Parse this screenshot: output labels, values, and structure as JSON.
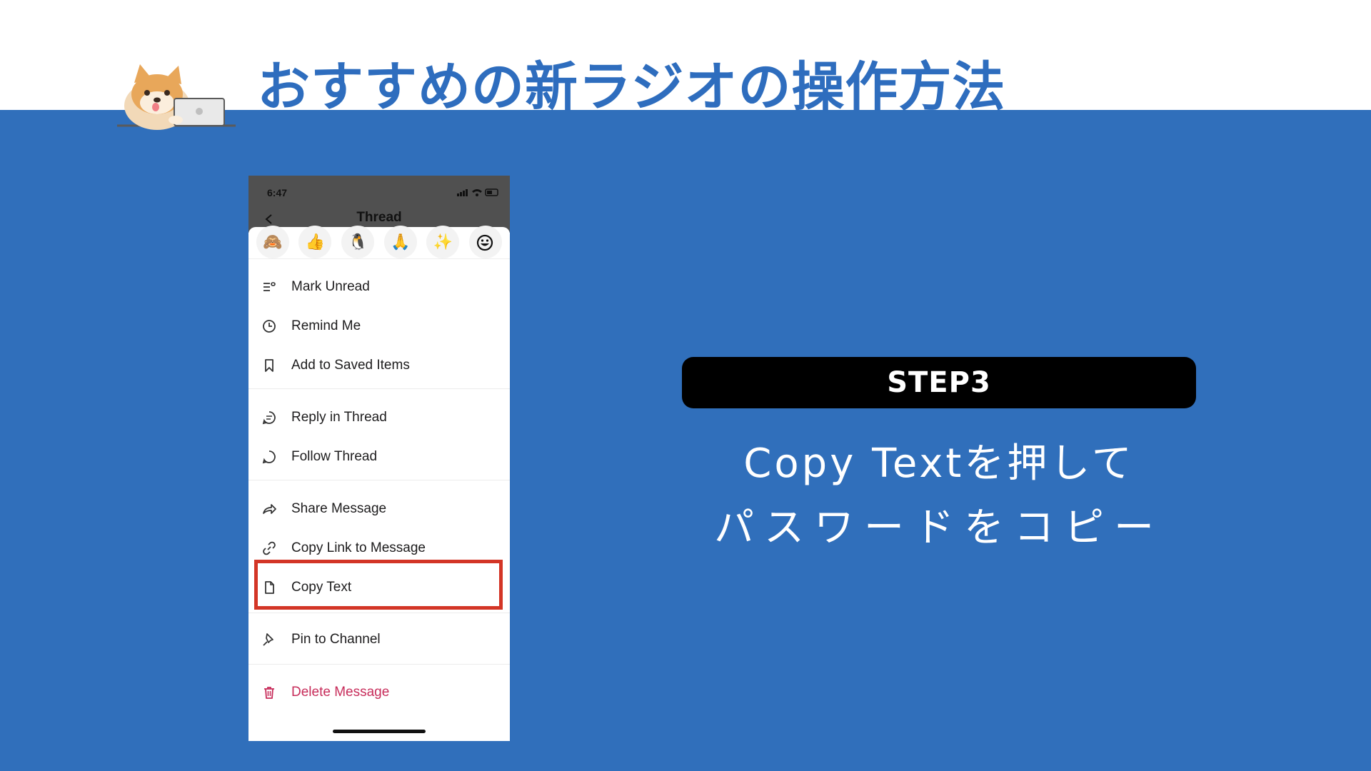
{
  "header": {
    "title": "おすすめの新ラジオの操作方法"
  },
  "phone": {
    "status_time": "6:47",
    "nav_title": "Thread",
    "reactions": [
      "🙈",
      "👍",
      "🐧",
      "🙏",
      "✨",
      "smiley-add-icon"
    ],
    "menu": [
      {
        "label": "Mark Unread",
        "icon": "mark-unread-icon"
      },
      {
        "label": "Remind Me",
        "icon": "clock-icon"
      },
      {
        "label": "Add to Saved Items",
        "icon": "bookmark-icon"
      },
      {
        "label": "Reply in Thread",
        "icon": "reply-thread-icon"
      },
      {
        "label": "Follow Thread",
        "icon": "follow-thread-icon"
      },
      {
        "label": "Share Message",
        "icon": "share-icon"
      },
      {
        "label": "Copy Link to Message",
        "icon": "link-icon"
      },
      {
        "label": "Copy Text",
        "icon": "document-icon"
      },
      {
        "label": "Pin to Channel",
        "icon": "pin-icon"
      },
      {
        "label": "Delete Message",
        "icon": "trash-icon"
      }
    ]
  },
  "panel": {
    "step_label": "STEP3",
    "line1": "Copy Textを押して",
    "line2": "パスワードをコピー"
  },
  "colors": {
    "background_blue": "#306fbb",
    "title_blue": "#2e6dbe",
    "highlight_red": "#d33526",
    "danger_pink": "#c72c5a"
  }
}
